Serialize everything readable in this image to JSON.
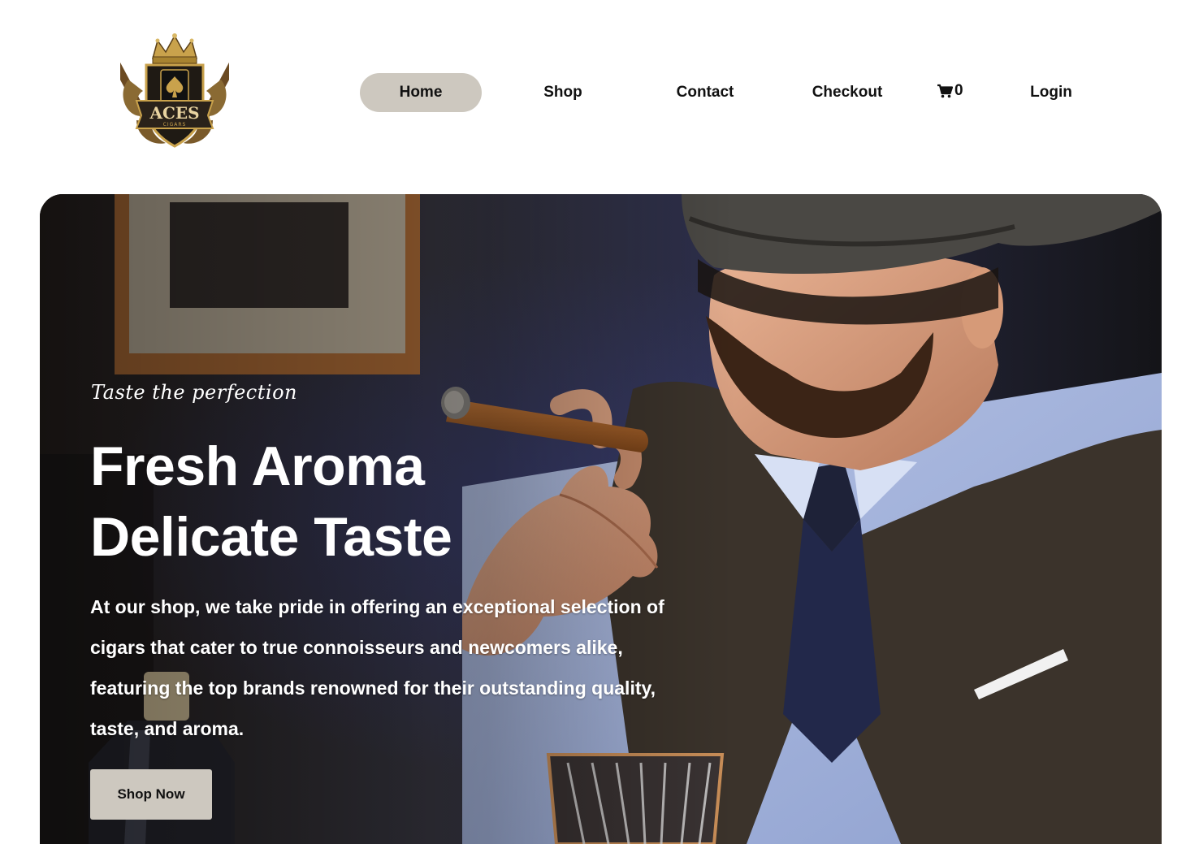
{
  "brand": {
    "logo_text": "ACES",
    "logo_subtext": "CIGARS"
  },
  "nav": {
    "items": [
      {
        "label": "Home",
        "active": true
      },
      {
        "label": "Shop",
        "active": false
      },
      {
        "label": "Contact",
        "active": false
      },
      {
        "label": "Checkout",
        "active": false
      }
    ],
    "cart_icon": "shopping-cart-icon",
    "cart_count": "0",
    "login_label": "Login"
  },
  "hero": {
    "tagline": "Taste the perfection",
    "headline_line1": "Fresh Aroma",
    "headline_line2": "Delicate Taste",
    "description": "At our shop, we take pride in offering an exceptional selection of cigars that cater to true connoisseurs and newcomers alike, featuring the top brands renowned for their outstanding quality, taste, and aroma.",
    "cta_label": "Shop Now"
  },
  "colors": {
    "accent_pill": "#cdc8bf",
    "nav_text": "#111111",
    "hero_text": "#ffffff"
  }
}
